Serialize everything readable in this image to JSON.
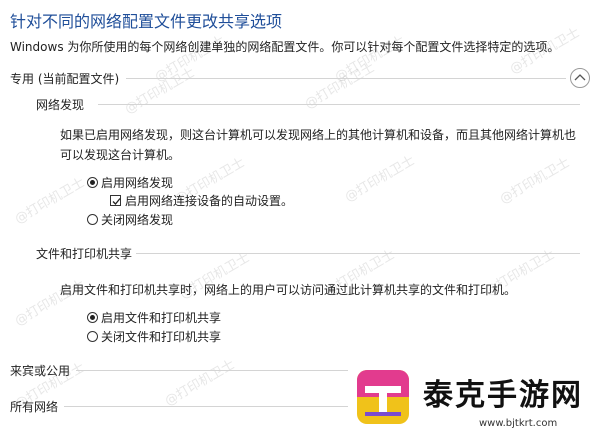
{
  "title": "针对不同的网络配置文件更改共享选项",
  "description": "Windows 为你所使用的每个网络创建单独的网络配置文件。你可以针对每个配置文件选择特定的选项。",
  "private_section": {
    "label": "专用 (当前配置文件)",
    "network_discovery": {
      "heading": "网络发现",
      "text_line1": "如果已启用网络发现，则这台计算机可以发现网络上的其他计算机和设备，而且其他网络计算机也",
      "text_line2": "可以发现这台计算机。",
      "options": {
        "enable": "启用网络发现",
        "auto_setup": "启用网络连接设备的自动设置。",
        "disable": "关闭网络发现"
      }
    },
    "file_printer_sharing": {
      "heading": "文件和打印机共享",
      "text": "启用文件和打印机共享时，网络上的用户可以访问通过此计算机共享的文件和打印机。",
      "options": {
        "enable": "启用文件和打印机共享",
        "disable": "关闭文件和打印机共享"
      }
    }
  },
  "guest_public_section": {
    "label": "来宾或公用"
  },
  "all_networks_section": {
    "label": "所有网络"
  },
  "watermark": "@打印机卫士",
  "logo": {
    "name": "泰克手游网",
    "url": "www.bjtkrt.com"
  }
}
